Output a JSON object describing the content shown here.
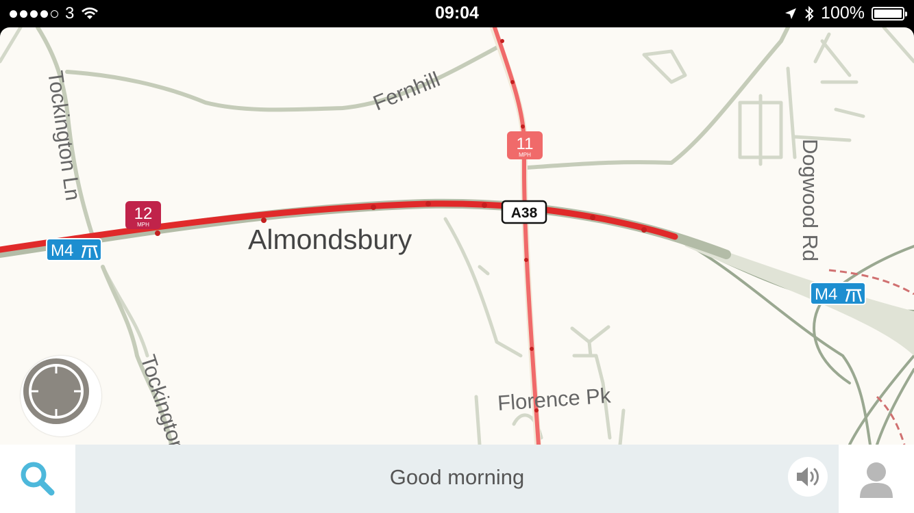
{
  "status_bar": {
    "carrier": "3",
    "time": "09:04",
    "battery": "100%"
  },
  "map": {
    "town_label": "Almondsbury",
    "road_labels": {
      "fernhill": "Fernhill",
      "tockington_ln": "Tockington Ln",
      "tockington_partial": "Tockington",
      "dogwood_rd": "Dogwood Rd",
      "florence_pk": "Florence Pk"
    },
    "road_shields": {
      "a38": "A38",
      "m4_west": "M4",
      "m4_east": "M4"
    },
    "speed_markers": [
      {
        "value": "12",
        "unit": "MPH"
      },
      {
        "value": "11",
        "unit": "MPH"
      }
    ],
    "colors": {
      "background": "#fcfaf5",
      "minor_road": "#c8cfbd",
      "motorway": "#a9b59d",
      "heavy_traffic": "#e02a2a",
      "moderate_traffic": "#f06a6a",
      "motorway_shield": "#1d8ed0"
    }
  },
  "bottom_bar": {
    "greeting": "Good morning"
  }
}
